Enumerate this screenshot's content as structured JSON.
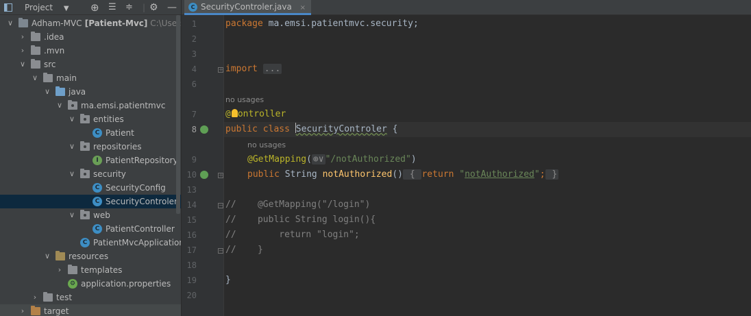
{
  "project_panel": {
    "title": "Project",
    "tree": [
      {
        "depth": 0,
        "arrow": "down",
        "icon": "module-folder",
        "label": "Adham-MVC",
        "bold": "[Patient-Mvc]",
        "path": "C:\\Users\\as"
      },
      {
        "depth": 1,
        "arrow": "right",
        "icon": "folder",
        "label": ".idea"
      },
      {
        "depth": 1,
        "arrow": "right",
        "icon": "folder",
        "label": ".mvn"
      },
      {
        "depth": 1,
        "arrow": "down",
        "icon": "folder",
        "label": "src"
      },
      {
        "depth": 2,
        "arrow": "down",
        "icon": "folder",
        "label": "main"
      },
      {
        "depth": 3,
        "arrow": "down",
        "icon": "source-folder",
        "label": "java"
      },
      {
        "depth": 4,
        "arrow": "down",
        "icon": "package",
        "label": "ma.emsi.patientmvc"
      },
      {
        "depth": 5,
        "arrow": "down",
        "icon": "package",
        "label": "entities"
      },
      {
        "depth": 6,
        "arrow": "",
        "icon": "class",
        "label": "Patient"
      },
      {
        "depth": 5,
        "arrow": "down",
        "icon": "package",
        "label": "repositories"
      },
      {
        "depth": 6,
        "arrow": "",
        "icon": "interface",
        "label": "PatientRepository"
      },
      {
        "depth": 5,
        "arrow": "down",
        "icon": "package",
        "label": "security"
      },
      {
        "depth": 6,
        "arrow": "",
        "icon": "class",
        "label": "SecurityConfig"
      },
      {
        "depth": 6,
        "arrow": "",
        "icon": "class",
        "label": "SecurityControler",
        "selected": true
      },
      {
        "depth": 5,
        "arrow": "down",
        "icon": "package",
        "label": "web"
      },
      {
        "depth": 6,
        "arrow": "",
        "icon": "class",
        "label": "PatientController"
      },
      {
        "depth": 5,
        "arrow": "",
        "icon": "spring-class",
        "label": "PatientMvcApplication"
      },
      {
        "depth": 3,
        "arrow": "down",
        "icon": "resources-folder",
        "label": "resources"
      },
      {
        "depth": 4,
        "arrow": "right",
        "icon": "folder",
        "label": "templates"
      },
      {
        "depth": 4,
        "arrow": "",
        "icon": "properties",
        "label": "application.properties"
      },
      {
        "depth": 2,
        "arrow": "right",
        "icon": "folder",
        "label": "test"
      },
      {
        "depth": 1,
        "arrow": "right",
        "icon": "target-folder",
        "label": "target",
        "gray": true
      }
    ]
  },
  "editor": {
    "tab": {
      "label": "SecurityControler.java",
      "close": "×"
    },
    "line_numbers": [
      "1",
      "2",
      "3",
      "4",
      "6",
      "7",
      "8",
      "9",
      "10",
      "13",
      "14",
      "15",
      "16",
      "17",
      "18",
      "19",
      "20"
    ],
    "hints": {
      "usages1": "no usages",
      "usages2": "no usages"
    },
    "code": {
      "l1_kw": "package",
      "l1_rest": " ma.emsi.patientmvc.security;",
      "l4_kw": "import",
      "l4_fold": "...",
      "l7_at": "@",
      "l7_ann": "ontroller",
      "l8_kw": "public class ",
      "l8_cls": "SecurityControler",
      "l8_brace": " {",
      "l9_ann": "@GetMapping",
      "l9_open": "(",
      "l9_web": "⊕∨",
      "l9_str": "\"/notAuthorized\"",
      "l9_close": ")",
      "l10_kw": "public ",
      "l10_type": "String ",
      "l10_fn": "notAuthorized",
      "l10_paren": "()",
      "l10_fold_open": " { ",
      "l10_ret": "return ",
      "l10_str_q1": "\"",
      "l10_str": "notAuthorized",
      "l10_str_q2": "\"",
      "l10_semi": ";",
      "l10_fold_close": " }",
      "l14": "//    @GetMapping(\"/login\")",
      "l15": "//    public String login(){",
      "l16": "//        return \"login\";",
      "l17": "//    }",
      "l19": "}"
    }
  }
}
